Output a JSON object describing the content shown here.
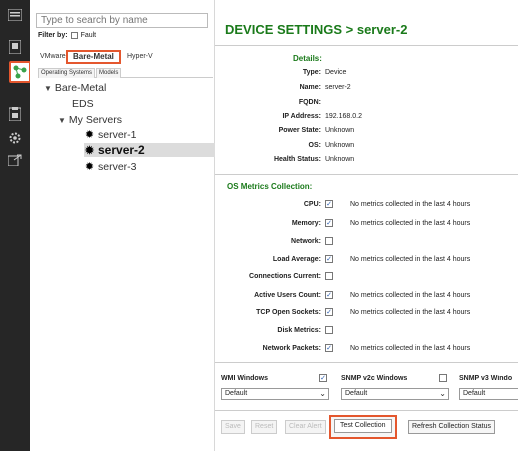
{
  "search": {
    "placeholder": "Type to search by name"
  },
  "filter": {
    "label": "Filter by:",
    "fault": "Fault"
  },
  "tabs": [
    "VMware",
    "Bare-Metal",
    "Hyper-V"
  ],
  "subtabs": [
    "Operating Systems",
    "Models"
  ],
  "tree": {
    "root": "Bare-Metal",
    "eds": "EDS",
    "group": "My Servers",
    "servers": [
      "server-1",
      "server-2",
      "server-3"
    ]
  },
  "title": "DEVICE SETTINGS > server-2",
  "details": {
    "section": "Details:",
    "rows": [
      {
        "label": "Type:",
        "value": "Device"
      },
      {
        "label": "Name:",
        "value": "server-2"
      },
      {
        "label": "FQDN:",
        "value": ""
      },
      {
        "label": "IP Address:",
        "value": "192.168.0.2"
      },
      {
        "label": "Power State:",
        "value": "Unknown"
      },
      {
        "label": "OS:",
        "value": "Unknown"
      },
      {
        "label": "Health Status:",
        "value": "Unknown"
      }
    ]
  },
  "metrics": {
    "section": "OS Metrics Collection:",
    "rows": [
      {
        "label": "CPU:",
        "checked": true,
        "note": "No metrics collected in the last 4 hours"
      },
      {
        "label": "Memory:",
        "checked": true,
        "note": "No metrics collected in the last 4 hours"
      },
      {
        "label": "Network:",
        "checked": false,
        "note": ""
      },
      {
        "label": "Load Average:",
        "checked": true,
        "note": "No metrics collected in the last 4 hours"
      },
      {
        "label": "Connections Current:",
        "checked": false,
        "note": ""
      },
      {
        "label": "Active Users Count:",
        "checked": true,
        "note": "No metrics collected in the last 4 hours"
      },
      {
        "label": "TCP Open Sockets:",
        "checked": true,
        "note": "No metrics collected in the last 4 hours"
      },
      {
        "label": "Disk Metrics:",
        "checked": false,
        "note": ""
      },
      {
        "label": "Network Packets:",
        "checked": true,
        "note": "No metrics collected in the last 4 hours"
      }
    ]
  },
  "collectors": [
    {
      "label": "WMI Windows",
      "checked": true,
      "value": "Default"
    },
    {
      "label": "SNMP v2c Windows",
      "checked": false,
      "value": "Default"
    },
    {
      "label": "SNMP v3 Windo",
      "checked": false,
      "value": "Default"
    }
  ],
  "buttons": {
    "save": "Save",
    "reset": "Reset",
    "clear": "Clear Alert",
    "test": "Test Collection",
    "refresh": "Refresh Collection Status"
  },
  "check_mark": "✓",
  "colors": {
    "accent": "#1a7a1a",
    "highlight": "#e4572e",
    "rail": "#262626"
  }
}
